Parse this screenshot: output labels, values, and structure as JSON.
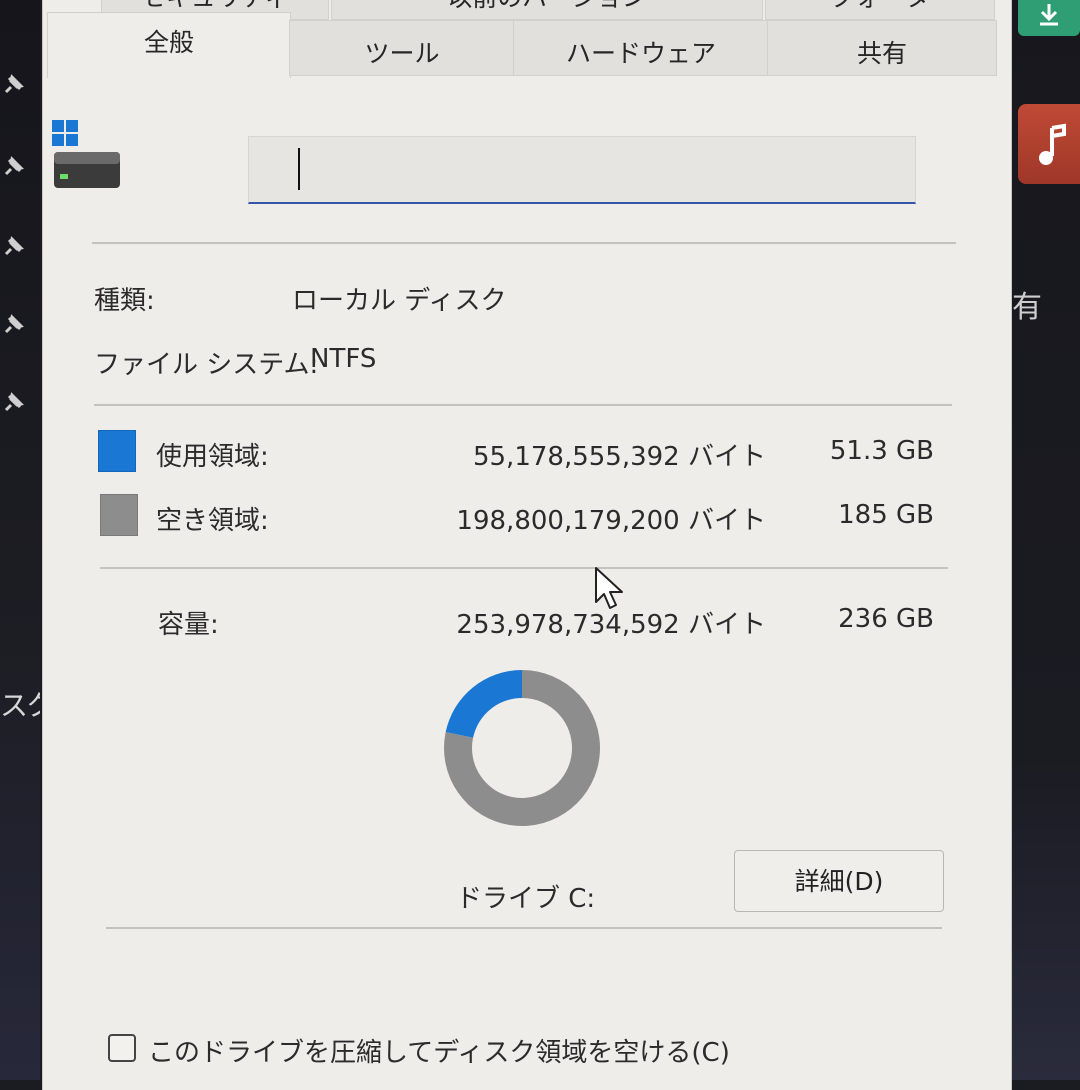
{
  "background": {
    "left_text": "スク",
    "right_text": "有"
  },
  "tabs": {
    "upper": [
      "セキュリティ",
      "以前のバージョン",
      "クォータ"
    ],
    "lower": [
      "全般",
      "ツール",
      "ハードウェア",
      "共有"
    ],
    "selected": "全般"
  },
  "general": {
    "drive_name_value": "",
    "type_label": "種類:",
    "type_value": "ローカル ディスク",
    "fs_label": "ファイル システム:",
    "fs_value": "NTFS",
    "used_label": "使用領域:",
    "used_bytes": "55,178,555,392 バイト",
    "used_size": "51.3 GB",
    "free_label": "空き領域:",
    "free_bytes": "198,800,179,200 バイト",
    "free_size": "185 GB",
    "capacity_label": "容量:",
    "capacity_bytes": "253,978,734,592 バイト",
    "capacity_size": "236 GB",
    "drive_label": "ドライブ C:",
    "details_button": "詳細(D)",
    "compress_label": "このドライブを圧縮してディスク領域を空ける(C)",
    "compress_checked": false
  },
  "chart_data": {
    "type": "pie",
    "categories": [
      "使用領域",
      "空き領域"
    ],
    "values": [
      55178555392,
      198800179200
    ],
    "colors": [
      "#1a78d4",
      "#8d8d8d"
    ]
  },
  "colors": {
    "used": "#1a78d4",
    "free": "#8d8d8d",
    "accent": "#3456a8"
  }
}
